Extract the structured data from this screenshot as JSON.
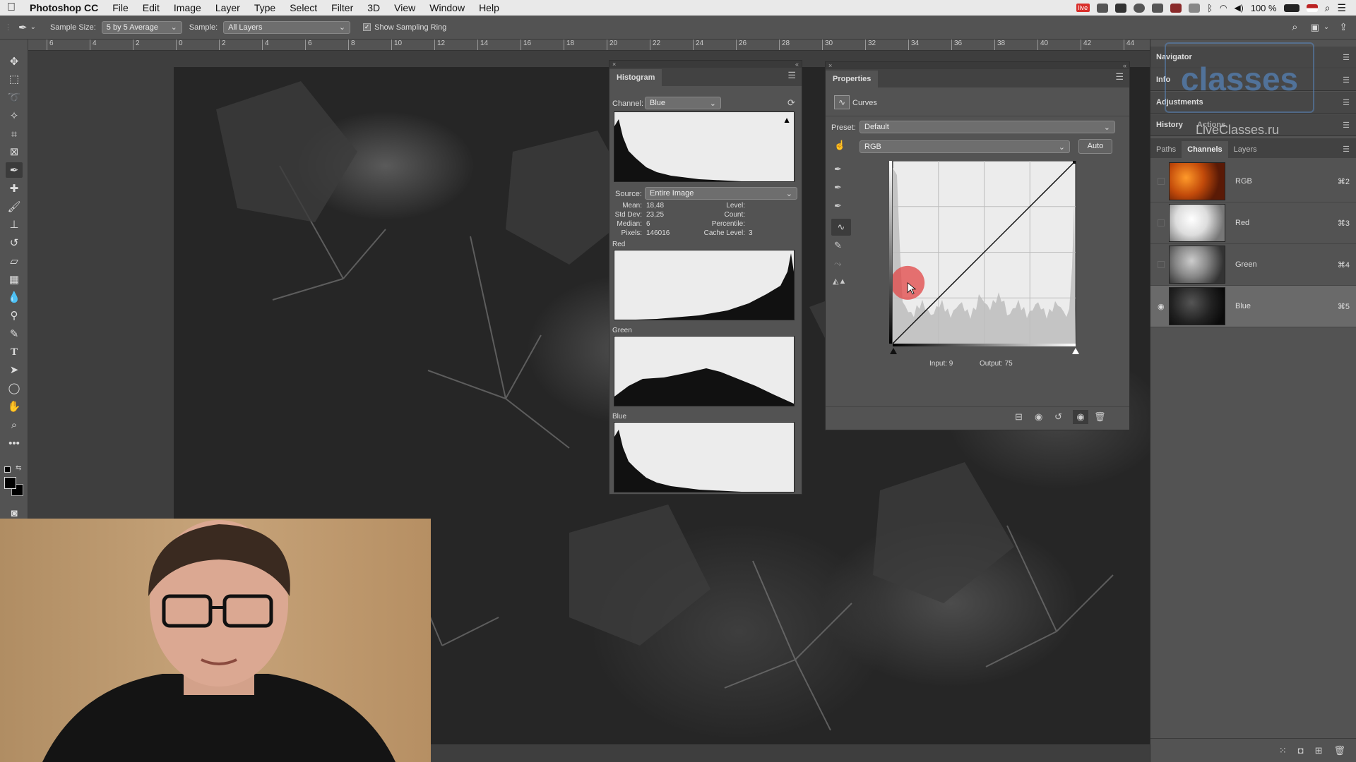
{
  "menubar": {
    "apple": "",
    "app": "Photoshop CC",
    "items": [
      "File",
      "Edit",
      "Image",
      "Layer",
      "Type",
      "Select",
      "Filter",
      "3D",
      "View",
      "Window",
      "Help"
    ],
    "battery": "100 %",
    "live_badge": "live"
  },
  "options": {
    "sample_size_label": "Sample Size:",
    "sample_size_value": "5 by 5 Average",
    "sample_label": "Sample:",
    "sample_value": "All Layers",
    "sampling_ring_label": "Show Sampling Ring",
    "sampling_ring_checked": true
  },
  "ruler": {
    "ticks": [
      "6",
      "4",
      "2",
      "0",
      "2",
      "4",
      "6",
      "8",
      "10",
      "12",
      "14",
      "16",
      "18",
      "20",
      "22",
      "24",
      "26",
      "28",
      "30",
      "32",
      "34",
      "36",
      "38",
      "40",
      "42",
      "44"
    ]
  },
  "histogram": {
    "tab": "Histogram",
    "channel_label": "Channel:",
    "channel_value": "Blue",
    "source_label": "Source:",
    "source_value": "Entire Image",
    "mean_label": "Mean:",
    "mean": "18,48",
    "stddev_label": "Std Dev:",
    "stddev": "23,25",
    "median_label": "Median:",
    "median": "6",
    "pixels_label": "Pixels:",
    "pixels": "146016",
    "level_label": "Level:",
    "count_label": "Count:",
    "percentile_label": "Percentile:",
    "cache_label": "Cache Level:",
    "cache": "3",
    "channels": [
      "Red",
      "Green",
      "Blue"
    ]
  },
  "properties": {
    "tab": "Properties",
    "type": "Curves",
    "preset_label": "Preset:",
    "preset_value": "Default",
    "channel_value": "RGB",
    "auto_label": "Auto",
    "input_label": "Input: 9",
    "output_label": "Output: 75",
    "curve_point": {
      "input": 9,
      "output": 75
    }
  },
  "dock": {
    "navigator": "Navigator",
    "info": "Info",
    "adjustments": "Adjustments",
    "history": "History",
    "actions": "Actions",
    "tabs": [
      "Paths",
      "Channels",
      "Layers"
    ],
    "active_tab": "Channels",
    "watermark": "classes",
    "watermark_url": "LiveClasses.ru",
    "channels": [
      {
        "name": "RGB",
        "shortcut": "⌘2",
        "visible": false
      },
      {
        "name": "Red",
        "shortcut": "⌘3",
        "visible": false
      },
      {
        "name": "Green",
        "shortcut": "⌘4",
        "visible": false
      },
      {
        "name": "Blue",
        "shortcut": "⌘5",
        "visible": true
      }
    ]
  }
}
